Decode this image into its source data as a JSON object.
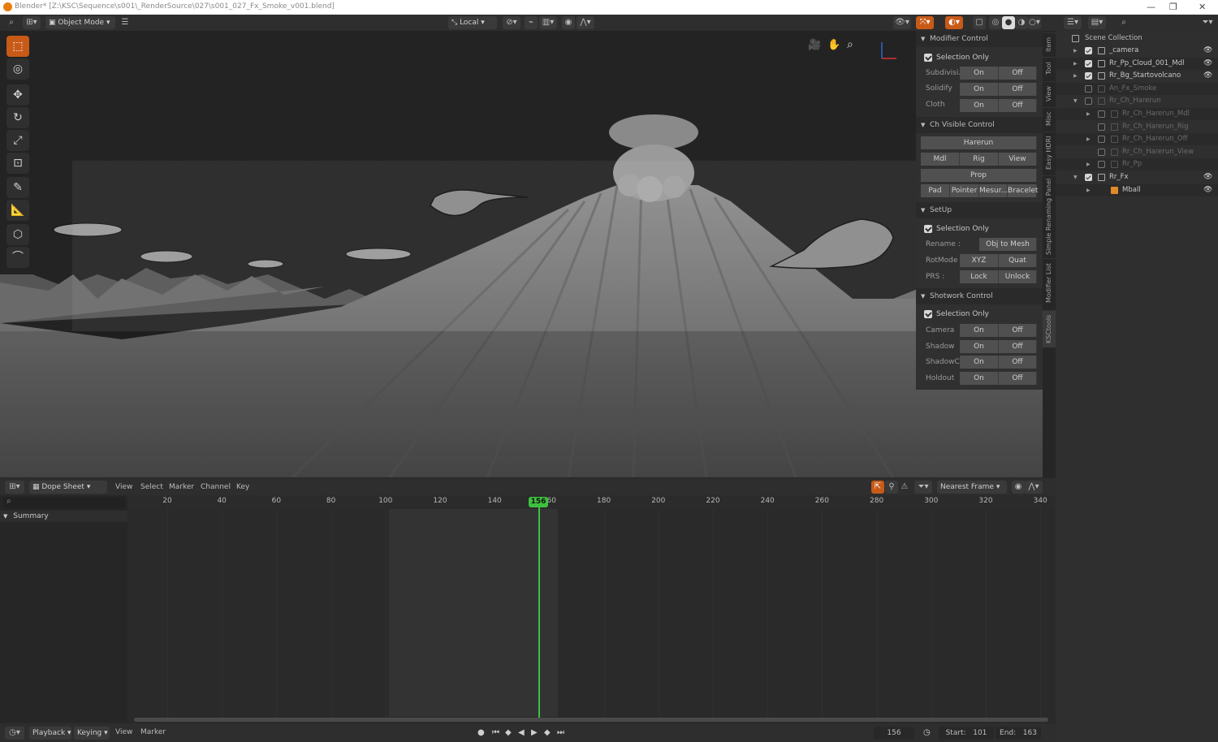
{
  "window": {
    "title": "Blender* [Z:\\KSC\\Sequence\\s001\\_RenderSource\\027\\s001_027_Fx_Smoke_v001.blend]"
  },
  "viewport_header": {
    "mode": "Object Mode",
    "orientation": "Local"
  },
  "npanel": {
    "modifier_control": {
      "title": "Modifier Control",
      "selection_only": "Selection Only",
      "rows": [
        {
          "label": "Subdivisi...",
          "on": "On",
          "off": "Off"
        },
        {
          "label": "Solidify",
          "on": "On",
          "off": "Off"
        },
        {
          "label": "Cloth",
          "on": "On",
          "off": "Off"
        }
      ]
    },
    "ch_visible": {
      "title": "Ch Visible Control",
      "hareru": "Harerun",
      "buttons1": [
        "Mdl",
        "Rig",
        "View"
      ],
      "prop": "Prop",
      "buttons2": [
        "Pad",
        "Pointer",
        "Mesur...",
        "Bracelet"
      ]
    },
    "setup": {
      "title": "SetUp",
      "selection_only": "Selection Only",
      "rename_label": "Rename :",
      "rename_btn": "Obj to Mesh",
      "rotmode_label": "RotMode :",
      "rotmode_a": "XYZ",
      "rotmode_b": "Quat",
      "prs_label": "PRS :",
      "prs_a": "Lock",
      "prs_b": "Unlock"
    },
    "shotwork": {
      "title": "Shotwork Control",
      "selection_only": "Selection Only",
      "rows": [
        {
          "label": "Camera",
          "on": "On",
          "off": "Off"
        },
        {
          "label": "Shadow",
          "on": "On",
          "off": "Off"
        },
        {
          "label": "ShadowC...",
          "on": "On",
          "off": "Off"
        },
        {
          "label": "Holdout",
          "on": "On",
          "off": "Off"
        }
      ]
    }
  },
  "side_tabs": [
    "Item",
    "Tool",
    "View",
    "Misc",
    "Easy HDRI",
    "Simple Renaming Panel",
    "Modifier List",
    "KSCtools"
  ],
  "outliner": {
    "root": "Scene Collection",
    "items": [
      {
        "name": "_camera",
        "checked": true,
        "eye": true,
        "dim": false
      },
      {
        "name": "Rr_Pp_Cloud_001_Mdl",
        "checked": true,
        "eye": true,
        "dim": false
      },
      {
        "name": "Rr_Bg_Startovolcano",
        "checked": true,
        "eye": true,
        "dim": false
      },
      {
        "name": "An_Fx_Smoke",
        "checked": false,
        "eye": false,
        "dim": true
      },
      {
        "name": "Rr_Ch_Harerun",
        "checked": false,
        "eye": false,
        "dim": true
      },
      {
        "name": "Rr_Ch_Harerun_Mdl",
        "checked": false,
        "eye": false,
        "dim": true
      },
      {
        "name": "Rr_Ch_Harerun_Rig",
        "checked": false,
        "eye": false,
        "dim": true
      },
      {
        "name": "Rr_Ch_Harerun_Off",
        "checked": false,
        "eye": false,
        "dim": true
      },
      {
        "name": "Rr_Ch_Harerun_View",
        "checked": false,
        "eye": false,
        "dim": true
      },
      {
        "name": "Rr_Pp",
        "checked": false,
        "eye": false,
        "dim": true
      },
      {
        "name": "Rr_Fx",
        "checked": true,
        "eye": true,
        "dim": false
      },
      {
        "name": "Mball",
        "checked": null,
        "eye": true,
        "dim": false
      }
    ]
  },
  "dopesheet": {
    "editor": "Dope Sheet",
    "menus": [
      "View",
      "Select",
      "Marker",
      "Channel",
      "Key"
    ],
    "snap": "Nearest Frame",
    "summary": "Summary",
    "ticks": [
      "20",
      "40",
      "60",
      "80",
      "100",
      "120",
      "140",
      "160",
      "180",
      "200",
      "220",
      "240",
      "260",
      "280",
      "300",
      "320",
      "340"
    ],
    "current_frame": "156"
  },
  "timeline": {
    "menus": [
      "Playback",
      "Keying",
      "View",
      "Marker"
    ],
    "frame": "156",
    "start_label": "Start:",
    "start": "101",
    "end_label": "End:",
    "end": "163"
  }
}
